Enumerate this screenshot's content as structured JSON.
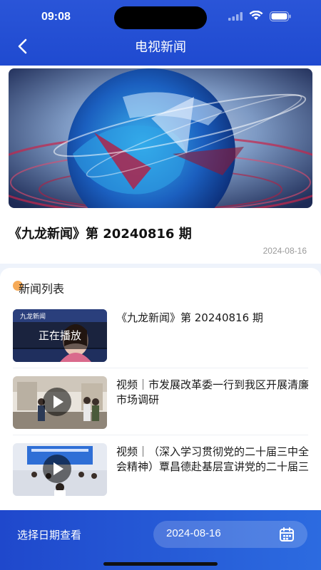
{
  "status": {
    "time": "09:08"
  },
  "nav": {
    "title": "电视新闻"
  },
  "featured": {
    "title": "《九龙新闻》第 20240816 期",
    "date": "2024-08-16"
  },
  "list": {
    "title": "新闻列表",
    "items": [
      {
        "title": "《九龙新闻》第 20240816 期",
        "badge": "正在播放",
        "thumb_caption": "九龙新闻"
      },
      {
        "title": "视频｜市发展改革委一行到我区开展清廉市场调研"
      },
      {
        "title": "视频｜（深入学习贯彻党的二十届三中全会精神）覃昌德赴基层宣讲党的二十届三中全会精神…"
      }
    ]
  },
  "bottom": {
    "label": "选择日期查看",
    "date": "2024-08-16"
  },
  "colors": {
    "header": "#2a55d8",
    "accent_dot": "#f59b3a"
  }
}
